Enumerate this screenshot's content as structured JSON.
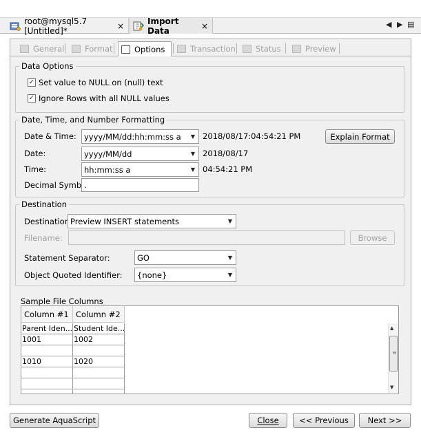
{
  "window_tabs": [
    {
      "label": "root@mysql5.7 [Untitled]*",
      "close": "×",
      "active": false
    },
    {
      "label": "Import Data",
      "close": "×",
      "active": true
    }
  ],
  "nav": {
    "prev": "◀",
    "next": "▶",
    "menu": "▤"
  },
  "subtabs": [
    {
      "label": "General",
      "enabled": false
    },
    {
      "label": "Format",
      "enabled": false
    },
    {
      "label": "Options",
      "enabled": true,
      "active": true
    },
    {
      "label": "Transaction",
      "enabled": false
    },
    {
      "label": "Status",
      "enabled": false
    },
    {
      "label": "Preview",
      "enabled": false
    }
  ],
  "data_options": {
    "title": "Data Options",
    "null_text": {
      "label": "Set value to NULL on (null) text",
      "checked": true,
      "mark": "✓"
    },
    "ignore_rows": {
      "label": "Ignore Rows with all NULL values",
      "checked": true,
      "mark": "✓"
    }
  },
  "formatting": {
    "title": "Date, Time, and Number Formatting",
    "datetime": {
      "label": "Date & Time:",
      "value": "yyyy/MM/dd:hh:mm:ss a",
      "preview": "2018/08/17:04:54:21 PM"
    },
    "date": {
      "label": "Date:",
      "value": "yyyy/MM/dd",
      "preview": "2018/08/17"
    },
    "time": {
      "label": "Time:",
      "value": "hh:mm:ss a",
      "preview": "04:54:21 PM"
    },
    "decimal": {
      "label": "Decimal Symbol:",
      "value": "."
    },
    "explain_button": "Explain Format"
  },
  "destination": {
    "title": "Destination",
    "destination": {
      "label": "Destination:",
      "value": "Preview INSERT statements"
    },
    "filename": {
      "label": "Filename:",
      "value": ""
    },
    "browse_button": "Browse",
    "separator": {
      "label": "Statement Separator:",
      "value": "GO"
    },
    "quoted": {
      "label": "Object Quoted Identifier:",
      "value": "{none}"
    }
  },
  "sample": {
    "title": "Sample File Columns",
    "headers": [
      "Column #1",
      "Column #2"
    ],
    "rows": [
      [
        "Parent Iden...",
        "Student Ide..."
      ],
      [
        "1001",
        "1002"
      ],
      [
        "",
        ""
      ],
      [
        "1010",
        "1020"
      ],
      [
        "",
        ""
      ],
      [
        "",
        ""
      ],
      [
        "",
        ""
      ]
    ]
  },
  "footer": {
    "generate": "Generate AquaScript",
    "close": "Close",
    "previous": "<< Previous",
    "next": "Next >>"
  },
  "colors": {
    "panel": "#f0f0f0",
    "border": "#a9a9a9"
  }
}
